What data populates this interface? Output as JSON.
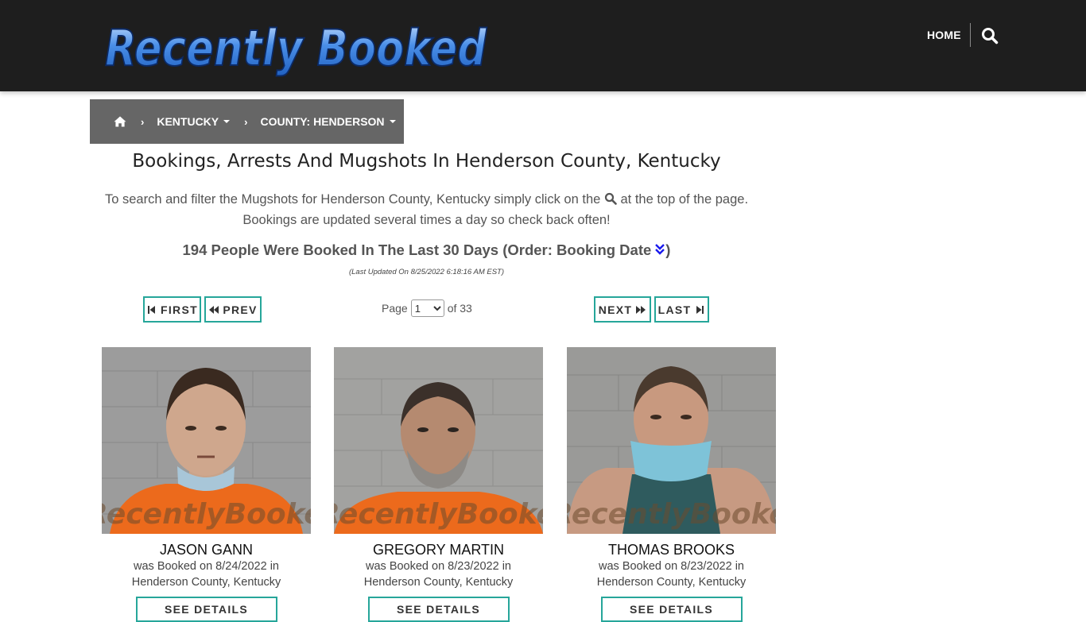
{
  "header": {
    "logo_text": "Recently Booked",
    "nav_home": "HOME"
  },
  "breadcrumb": {
    "state": "KENTUCKY",
    "county": "COUNTY: HENDERSON"
  },
  "main": {
    "title": "Bookings, Arrests And Mugshots In Henderson County, Kentucky",
    "desc_line1_before": "To search and filter the Mugshots for Henderson County, Kentucky simply click on the",
    "desc_line1_after": "at the top of the page.",
    "desc_line2": "Bookings are updated several times a day so check back often!",
    "count_text": "194 People Were Booked In The Last 30 Days (Order: Booking Date",
    "count_close": ")",
    "updated": "(Last Updated On 8/25/2022 6:18:16 AM EST)"
  },
  "pagination": {
    "first": "FIRST",
    "prev": "PREV",
    "next": "NEXT",
    "last": "LAST",
    "page_label": "Page",
    "current_page": "1",
    "of_label": "of 33"
  },
  "watermark": "RecentlyBooked.com",
  "bookings": [
    {
      "name": "JASON GANN",
      "line1": "was Booked on 8/24/2022 in",
      "line2": "Henderson County, Kentucky",
      "button": "SEE DETAILS"
    },
    {
      "name": "GREGORY MARTIN",
      "line1": "was Booked on 8/23/2022 in",
      "line2": "Henderson County, Kentucky",
      "button": "SEE DETAILS"
    },
    {
      "name": "THOMAS BROOKS",
      "line1": "was Booked on 8/23/2022 in",
      "line2": "Henderson County, Kentucky",
      "button": "SEE DETAILS"
    }
  ],
  "colors": {
    "header_bg": "#1e1e1e",
    "breadcrumb_bg": "#666666",
    "button_border": "#26a69a",
    "logo_blue": "#4a8fe8"
  }
}
